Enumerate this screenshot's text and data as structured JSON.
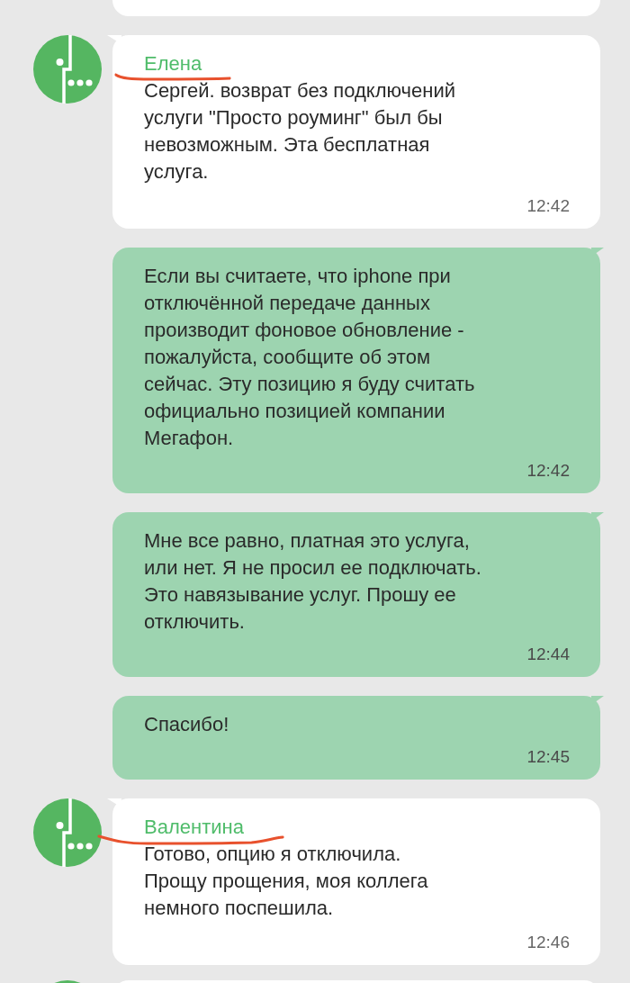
{
  "messages": [
    {
      "kind": "clipped"
    },
    {
      "kind": "incoming",
      "sender": "Елена",
      "text": "Сергей. возврат без подключений\nуслуги \"Просто роуминг\" был бы\nневозможным. Эта бесплатная\nуслуга.",
      "time": "12:42",
      "annotated": true
    },
    {
      "kind": "outgoing",
      "text": "Если вы считаете, что iphone при\nотключённой передаче данных\nпроизводит фоновое обновление -\nпожалуйста, сообщите об этом\nсейчас. Эту позицию я буду считать\nофициально позицией компании\nМегафон.",
      "time": "12:42"
    },
    {
      "kind": "outgoing",
      "text": "Мне все равно, платная это услуга,\nили нет. Я не просил ее подключать.\nЭто навязывание услуг. Прошу ее\nотключить.",
      "time": "12:44"
    },
    {
      "kind": "outgoing",
      "text": "Спасибо!",
      "time": "12:45"
    },
    {
      "kind": "incoming",
      "sender": "Валентина",
      "text": "Готово, опцию я отключила.\nПрощу прощения, моя коллега\nнемного поспешила.",
      "time": "12:46",
      "annotated": true
    },
    {
      "kind": "clipped"
    }
  ]
}
